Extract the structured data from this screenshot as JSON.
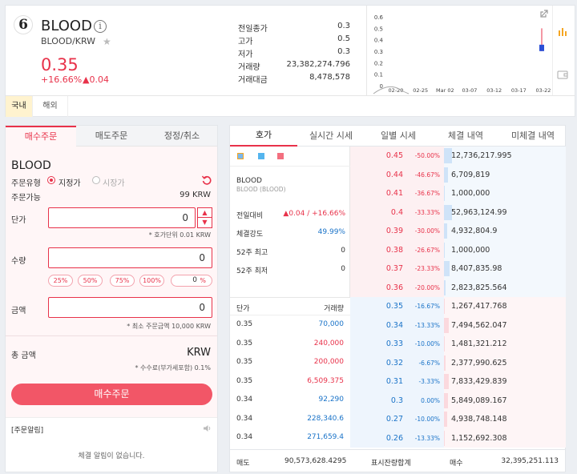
{
  "coin": {
    "logo_letter": "6",
    "name": "BLOOD",
    "pair": "BLOOD/KRW",
    "price": "0.35",
    "change_rate": "+16.66%",
    "change_amount": "▲0.04"
  },
  "stats": [
    {
      "label": "전일종가",
      "value": "0.3"
    },
    {
      "label": "고가",
      "value": "0.5"
    },
    {
      "label": "저가",
      "value": "0.3"
    },
    {
      "label": "거래량",
      "value": "23,382,274.796"
    },
    {
      "label": "거래대금",
      "value": "8,478,578"
    }
  ],
  "mini_chart": {
    "y_ticks": [
      "0.6",
      "0.5",
      "0.4",
      "0.3",
      "0.2",
      "0.1",
      "0"
    ],
    "x_ticks": [
      "02-20",
      "02-25",
      "Mar 02",
      "03-07",
      "03-12",
      "03-17",
      "03-22"
    ],
    "candle": {
      "open": 0.3,
      "close": 0.35,
      "high": 0.5,
      "low": 0.3
    }
  },
  "market_tabs": {
    "domestic": "국내",
    "overseas": "해외"
  },
  "order_tabs": {
    "buy": "매수주문",
    "sell": "매도주문",
    "edit": "정정/취소"
  },
  "order": {
    "coin": "BLOOD",
    "type_label": "주문유형",
    "limit_label": "지정가",
    "market_label": "시장가",
    "available_label": "주문가능",
    "available_value": "99 KRW",
    "price_label": "단가",
    "price_value": "0",
    "tick_note": "* 호가단위 0.01 KRW",
    "qty_label": "수량",
    "qty_value": "0",
    "pct_buttons": [
      "25%",
      "50%",
      "75%",
      "100%"
    ],
    "pct_custom_value": "0",
    "pct_custom_unit": "%",
    "amount_label": "금액",
    "amount_value": "0",
    "min_note": "* 최소 주문금액 10,000 KRW",
    "total_label": "총 금액",
    "total_unit": "KRW",
    "fee_note": "* 수수료(부가세포함) 0.1%",
    "buy_button": "매수주문",
    "notify_title": "[주문알림]",
    "notify_empty": "체결 알림이 없습니다."
  },
  "book_tabs": {
    "hoga": "호가",
    "realtime": "실시간 시세",
    "daily": "일별 시세",
    "filled": "체결 내역",
    "unfilled": "미체결 내역"
  },
  "book_info": {
    "coin": "BLOOD",
    "coin_full": "BLOOD (BLOOD)",
    "rows": [
      {
        "label": "전일대비",
        "value": "▲0.04 / +16.66%"
      },
      {
        "label": "체결강도",
        "value": "49.99%"
      },
      {
        "label": "52주 최고",
        "value": "0"
      },
      {
        "label": "52주 최저",
        "value": "0"
      }
    ]
  },
  "asks": [
    {
      "price": "0.45",
      "pct": "-50.00%",
      "volume": "12,736,217.995",
      "bar": 1.0
    },
    {
      "price": "0.44",
      "pct": "-46.67%",
      "volume": "6,709,819",
      "bar": 0.53
    },
    {
      "price": "0.41",
      "pct": "-36.67%",
      "volume": "1,000,000",
      "bar": 0.08
    },
    {
      "price": "0.4",
      "pct": "-33.33%",
      "volume": "52,963,124.99",
      "bar": 1.0
    },
    {
      "price": "0.39",
      "pct": "-30.00%",
      "volume": "4,932,804.9",
      "bar": 0.39
    },
    {
      "price": "0.38",
      "pct": "-26.67%",
      "volume": "1,000,000",
      "bar": 0.08
    },
    {
      "price": "0.37",
      "pct": "-23.33%",
      "volume": "8,407,835.98",
      "bar": 0.66
    },
    {
      "price": "0.36",
      "pct": "-20.00%",
      "volume": "2,823,825.564",
      "bar": 0.22
    }
  ],
  "bids": [
    {
      "price": "0.35",
      "pct": "-16.67%",
      "volume": "1,267,417.768",
      "bar": 0.1
    },
    {
      "price": "0.34",
      "pct": "-13.33%",
      "volume": "7,494,562.047",
      "bar": 0.59
    },
    {
      "price": "0.33",
      "pct": "-10.00%",
      "volume": "1,481,321.212",
      "bar": 0.12
    },
    {
      "price": "0.32",
      "pct": "-6.67%",
      "volume": "2,377,990.625",
      "bar": 0.19
    },
    {
      "price": "0.31",
      "pct": "-3.33%",
      "volume": "7,833,429.839",
      "bar": 0.62
    },
    {
      "price": "0.3",
      "pct": "0.00%",
      "volume": "5,849,089.167",
      "bar": 0.46
    },
    {
      "price": "0.27",
      "pct": "-10.00%",
      "volume": "4,938,748.148",
      "bar": 0.39
    },
    {
      "price": "0.26",
      "pct": "-13.33%",
      "volume": "1,152,692.308",
      "bar": 0.09
    }
  ],
  "trades_header": {
    "price": "단가",
    "volume": "거래량"
  },
  "trades": [
    {
      "price": "0.35",
      "volume": "70,000",
      "side": "bid"
    },
    {
      "price": "0.35",
      "volume": "240,000",
      "side": "ask"
    },
    {
      "price": "0.35",
      "volume": "200,000",
      "side": "ask"
    },
    {
      "price": "0.35",
      "volume": "6,509.375",
      "side": "ask"
    },
    {
      "price": "0.34",
      "volume": "92,290",
      "side": "bid"
    },
    {
      "price": "0.34",
      "volume": "228,340.6",
      "side": "bid"
    },
    {
      "price": "0.34",
      "volume": "271,659.4",
      "side": "bid"
    }
  ],
  "footer": {
    "ask_label": "매도",
    "ask_total": "90,573,628.4295",
    "mid_label": "표시잔량합계",
    "bid_label": "매수",
    "bid_total": "32,395,251.113"
  },
  "colors": {
    "up": "#e8324a",
    "down": "#1a73c8",
    "accent": "#f25667"
  }
}
